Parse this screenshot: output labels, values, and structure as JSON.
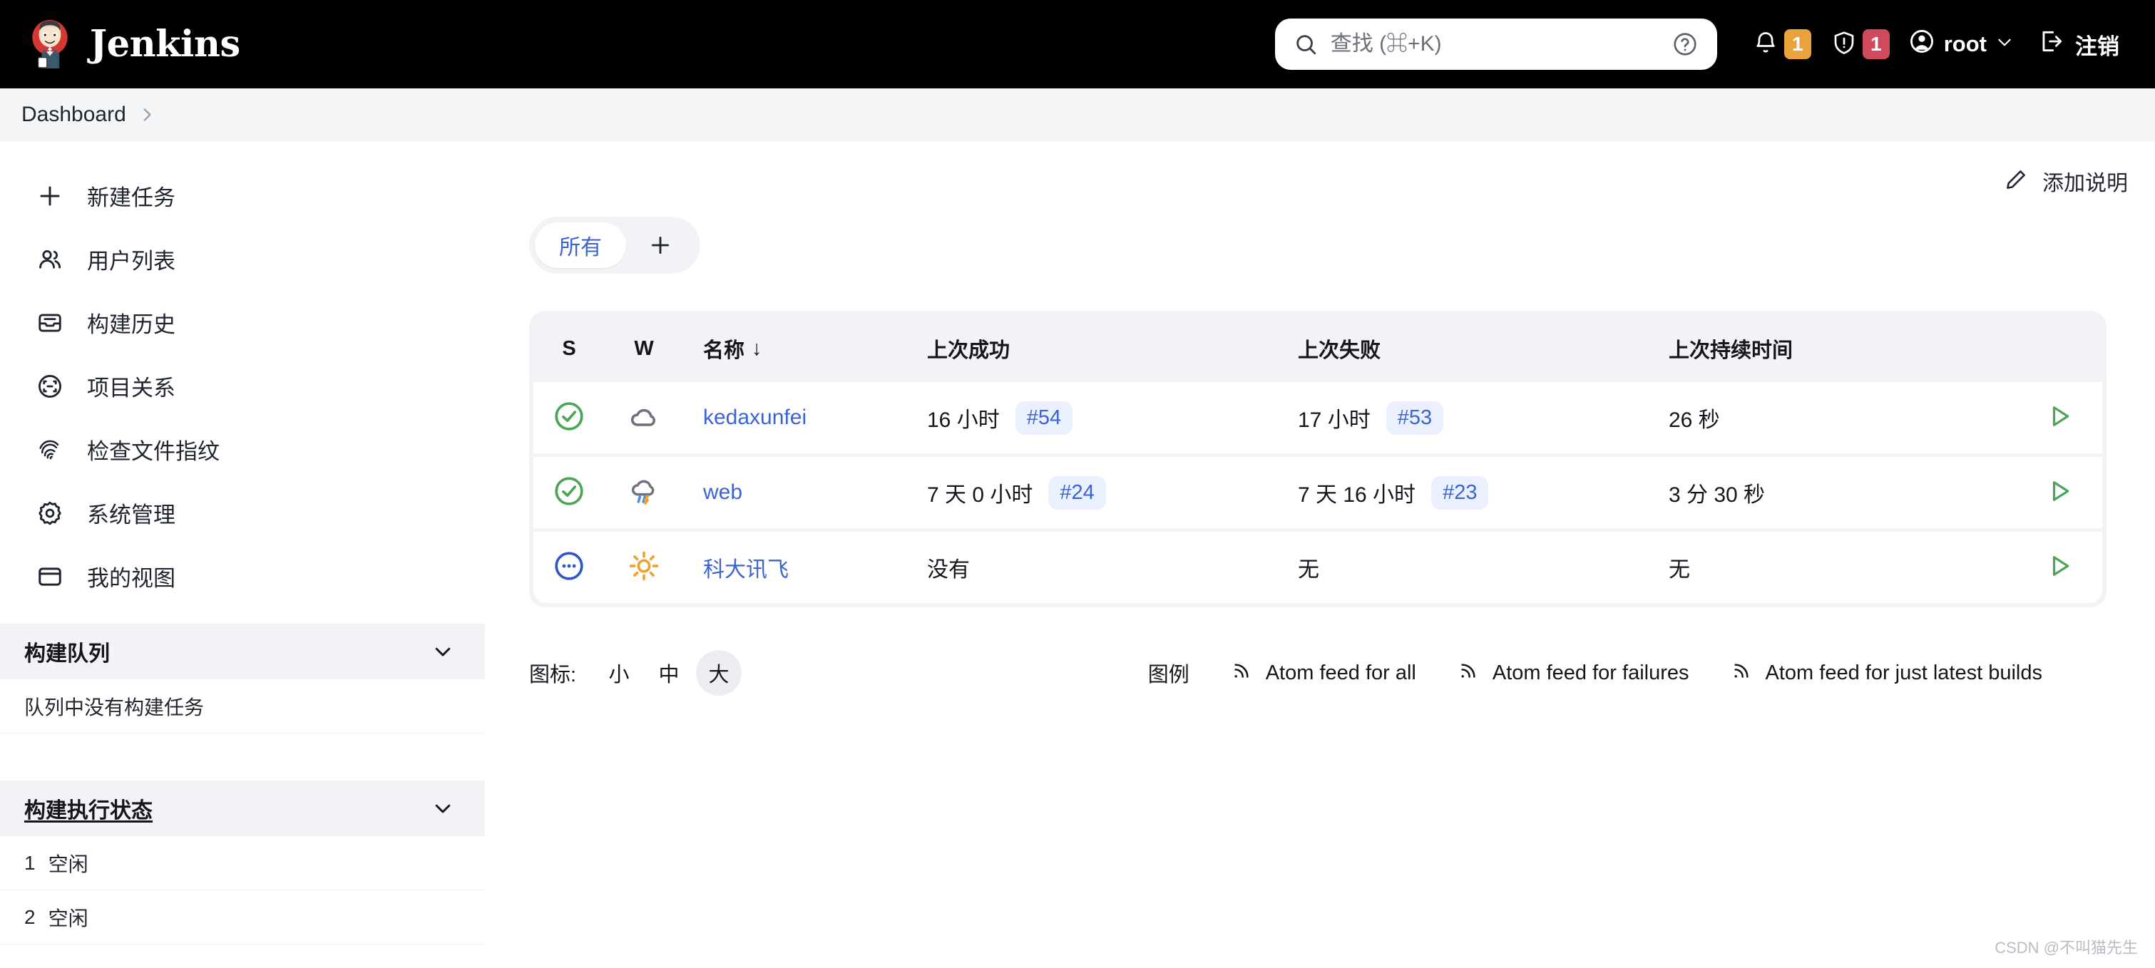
{
  "header": {
    "brand": "Jenkins",
    "brand_logo_icon": "jenkins-butler-logo",
    "search": {
      "icon": "search-icon",
      "placeholder": "查找 (⌘+K)",
      "value": "",
      "help_icon": "question-circle-icon"
    },
    "notifications": {
      "icon": "bell-icon",
      "count": "1",
      "color": "#e8a33d"
    },
    "security": {
      "icon": "shield-warning-icon",
      "count": "1",
      "color": "#d14a5c"
    },
    "user": {
      "icon": "user-circle-icon",
      "name": "root",
      "chevron": "chevron-down-icon"
    },
    "logout": {
      "icon": "logout-icon",
      "label": "注销"
    }
  },
  "breadcrumb": {
    "items": [
      "Dashboard"
    ],
    "separator_icon": "chevron-right-icon"
  },
  "sidebar": {
    "items": [
      {
        "label": "新建任务",
        "icon": "plus-icon"
      },
      {
        "label": "用户列表",
        "icon": "people-icon"
      },
      {
        "label": "构建历史",
        "icon": "inbox-icon"
      },
      {
        "label": "项目关系",
        "icon": "relationship-icon"
      },
      {
        "label": "检查文件指纹",
        "icon": "fingerprint-icon"
      },
      {
        "label": "系统管理",
        "icon": "gear-icon"
      },
      {
        "label": "我的视图",
        "icon": "window-icon"
      }
    ],
    "build_queue": {
      "title": "构建队列",
      "chevron": "chevron-down-icon",
      "empty_text": "队列中没有构建任务"
    },
    "build_executor": {
      "title": "构建执行状态",
      "chevron": "chevron-down-icon",
      "executors": [
        {
          "num": "1",
          "status": "空闲"
        },
        {
          "num": "2",
          "status": "空闲"
        }
      ]
    }
  },
  "main": {
    "add_description": {
      "label": "添加说明",
      "icon": "pencil-icon"
    },
    "tabs": [
      {
        "label": "所有",
        "active": true
      }
    ],
    "tab_add_icon": "plus-icon",
    "table": {
      "columns": [
        "S",
        "W",
        "名称",
        "上次成功",
        "上次失败",
        "上次持续时间"
      ],
      "sort_indicator": "↓",
      "sorted_column": "名称",
      "rows": [
        {
          "status_icon": "status-success-icon",
          "status_color": "#4aa557",
          "weather_icon": "weather-cloudy-icon",
          "name": "kedaxunfei",
          "last_success_time": "16 小时",
          "last_success_build": "#54",
          "last_failure_time": "17 小时",
          "last_failure_build": "#53",
          "duration": "26 秒",
          "run_icon": "play-icon"
        },
        {
          "status_icon": "status-success-icon",
          "status_color": "#4aa557",
          "weather_icon": "weather-storm-icon",
          "name": "web",
          "last_success_time": "7 天 0 小时",
          "last_success_build": "#24",
          "last_failure_time": "7 天 16 小时",
          "last_failure_build": "#23",
          "duration": "3 分 30 秒",
          "run_icon": "play-icon"
        },
        {
          "status_icon": "status-pending-icon",
          "status_color": "#2f56c8",
          "weather_icon": "weather-sunny-icon",
          "name": "科大讯飞",
          "last_success_time": "没有",
          "last_success_build": "",
          "last_failure_time": "无",
          "last_failure_build": "",
          "duration": "无",
          "run_icon": "play-icon"
        }
      ]
    },
    "footer": {
      "icon_size_label": "图标:",
      "sizes": [
        {
          "label": "小",
          "active": false
        },
        {
          "label": "中",
          "active": false
        },
        {
          "label": "大",
          "active": true
        }
      ],
      "legend_label": "图例",
      "feeds": [
        {
          "label": "Atom feed for all",
          "icon": "rss-icon"
        },
        {
          "label": "Atom feed for failures",
          "icon": "rss-icon"
        },
        {
          "label": "Atom feed for just latest builds",
          "icon": "rss-icon"
        }
      ]
    }
  },
  "watermark": "CSDN @不叫猫先生"
}
